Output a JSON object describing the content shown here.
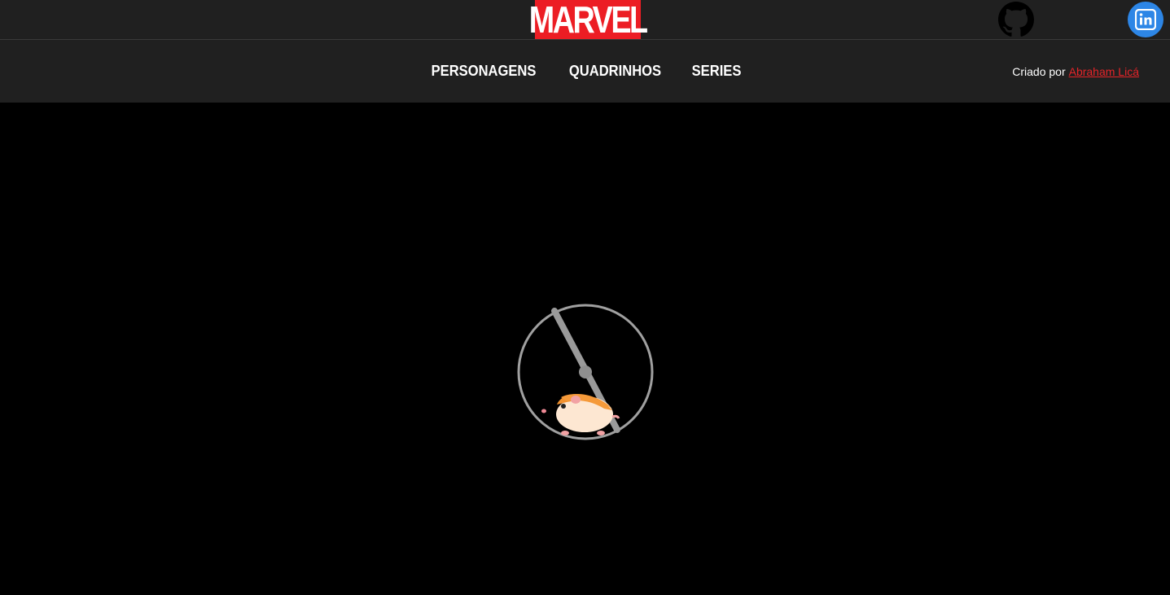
{
  "header": {
    "logo_text": "MARVEL",
    "logo_color": "#ec1d24",
    "github_icon": "github-icon",
    "linkedin_icon": "linkedin-icon",
    "linkedin_color": "#2d86e6"
  },
  "nav": {
    "items": [
      {
        "label": "PERSONAGENS"
      },
      {
        "label": "QUADRINHOS"
      },
      {
        "label": "SERIES"
      }
    ],
    "credit_prefix": "Criado por",
    "credit_name": "Abraham Licá",
    "credit_link_color": "#e62429"
  },
  "main": {
    "loader_icon": "hamster-wheel-icon"
  }
}
